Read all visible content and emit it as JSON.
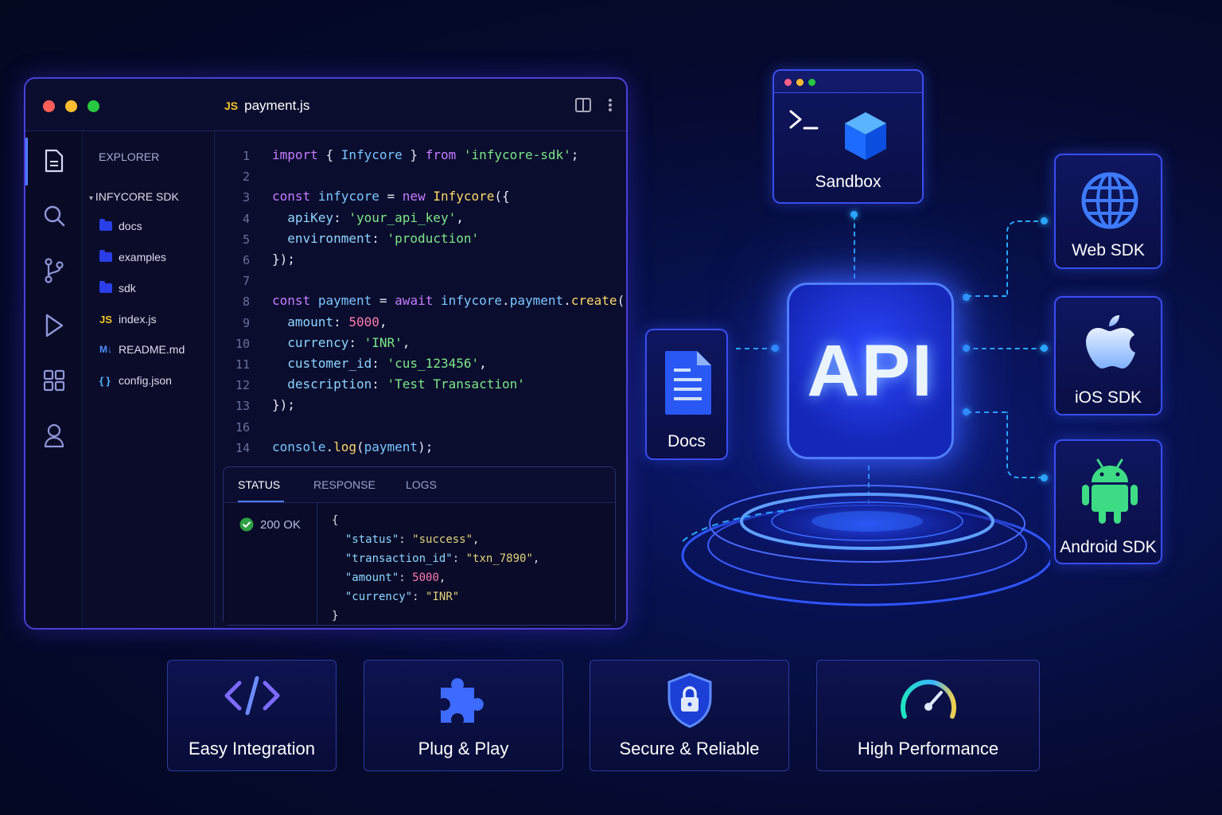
{
  "editor": {
    "file_badge": "JS",
    "file_name": "payment.js",
    "explorer_title": "EXPLORER",
    "project": "INFYCORE SDK",
    "files": [
      {
        "icon": "folder-icon",
        "name": "docs"
      },
      {
        "icon": "folder-icon",
        "name": "examples"
      },
      {
        "icon": "folder-icon",
        "name": "sdk"
      },
      {
        "icon": "js-file-icon",
        "badge": "JS",
        "name": "index.js"
      },
      {
        "icon": "markdown-file-icon",
        "badge": "M↓",
        "name": "README.md"
      },
      {
        "icon": "json-file-icon",
        "badge": "{ }",
        "name": "config.json"
      }
    ],
    "line_numbers": [
      "1",
      "2",
      "3",
      "4",
      "5",
      "6",
      "7",
      "8",
      "9",
      "10",
      "11",
      "12",
      "13",
      "16",
      "14"
    ],
    "code_lines": [
      "import { Infycore } from 'infycore-sdk';",
      "",
      "const infycore = new Infycore({",
      "  apiKey: 'your_api_key',",
      "  environment: 'production'",
      "});",
      "",
      "const payment = await infycore.payment.create({",
      "  amount: 5000,",
      "  currency: 'INR',",
      "  customer_id: 'cus_123456',",
      "  description: 'Test Transaction'",
      "});",
      "",
      "console.log(payment);"
    ],
    "panel_tabs": [
      "STATUS",
      "RESPONSE",
      "LOGS"
    ],
    "status": "200 OK",
    "response_lines": [
      "{",
      "  \"status\": \"success\",",
      "  \"transaction_id\": \"txn_7890\",",
      "  \"amount\": 5000,",
      "  \"currency\": \"INR\"",
      "}"
    ]
  },
  "diagram": {
    "center": "API",
    "sandbox": "Sandbox",
    "docs": "Docs",
    "web_sdk": "Web SDK",
    "ios_sdk": "iOS SDK",
    "android_sdk": "Android SDK"
  },
  "features": [
    "Easy Integration",
    "Plug & Play",
    "Secure & Reliable",
    "High Performance"
  ],
  "colors": {
    "accent": "#3a5cff",
    "glow": "#2aa8ff",
    "background": "#050a2e"
  }
}
